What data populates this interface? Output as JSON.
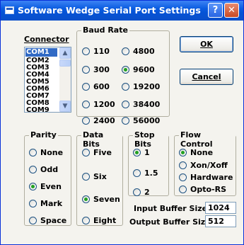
{
  "window": {
    "title": "Software Wedge Serial Port Settings",
    "help_glyph": "?",
    "close_glyph": "✕"
  },
  "connector": {
    "label": "Connector",
    "items": [
      "COM1",
      "COM2",
      "COM3",
      "COM4",
      "COM5",
      "COM6",
      "COM7",
      "COM8",
      "COM9"
    ],
    "selected": "COM1"
  },
  "baud": {
    "label": "Baud Rate",
    "options": [
      "110",
      "300",
      "600",
      "1200",
      "2400",
      "4800",
      "9600",
      "19200",
      "38400",
      "56000"
    ],
    "selected": "9600"
  },
  "parity": {
    "label": "Parity",
    "options": [
      "None",
      "Odd",
      "Even",
      "Mark",
      "Space"
    ],
    "selected": "Even"
  },
  "data_bits": {
    "label": "Data Bits",
    "options": [
      "Five",
      "Six",
      "Seven",
      "Eight"
    ],
    "selected": "Seven"
  },
  "stop_bits": {
    "label": "Stop Bits",
    "options": [
      "1",
      "1.5",
      "2"
    ],
    "selected": "1"
  },
  "flow": {
    "label": "Flow Control",
    "options": [
      "None",
      "Xon/Xoff",
      "Hardware",
      "Opto-RS"
    ],
    "selected": "None"
  },
  "buttons": {
    "ok": "OK",
    "cancel": "Cancel"
  },
  "buffers": {
    "input_label": "Input Buffer Size:",
    "input_value": "1024",
    "output_label": "Output Buffer Size:",
    "output_value": "512"
  },
  "colors": {
    "titlebar": "#0a5ce0",
    "selection": "#316ac5",
    "radio_dot": "#21a121"
  }
}
